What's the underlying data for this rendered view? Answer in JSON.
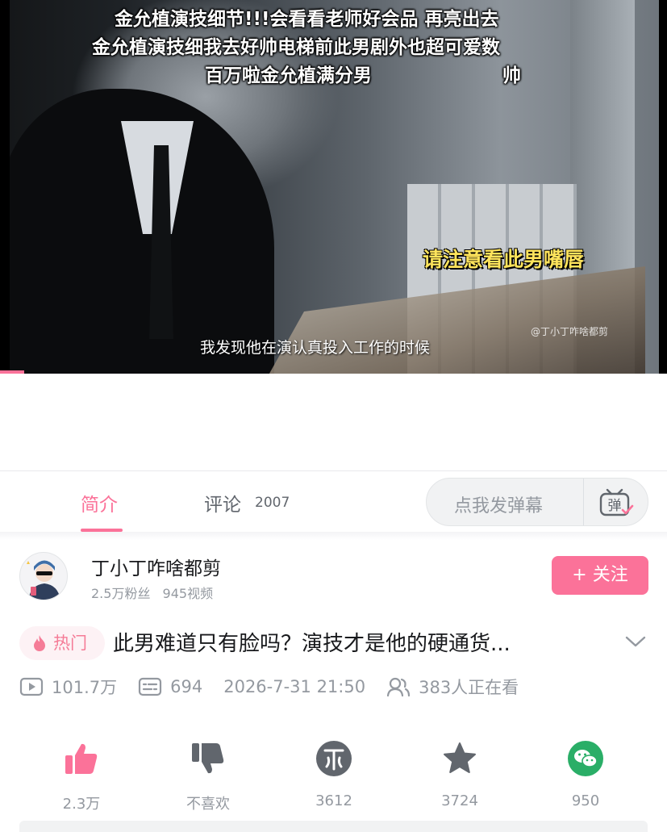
{
  "video": {
    "danmaku_lines": [
      "金允植演技细节!!!会看看老师好会品 再亮出去",
      "金允植演技细我去好帅电梯前此男剧外也超可爱数",
      "百万啦金允植满分男",
      "帅"
    ],
    "caption_highlight": "请注意看此男嘴唇",
    "subtitle": "我发现他在演认真投入工作的时候",
    "watermark": "@丁小丁咋啥都剪",
    "progress": 0.036
  },
  "tabs": {
    "intro_label": "简介",
    "comments_label": "评论",
    "comments_count": "2007",
    "danmaku_placeholder": "点我发弹幕",
    "danmaku_button_label": "弹"
  },
  "uploader": {
    "name": "丁小丁咋啥都剪",
    "fans": "2.5万粉丝",
    "videos": "945视频",
    "follow_label": "+ 关注"
  },
  "title": {
    "badge": "热门",
    "text": "此男难道只有脸吗？演技才是他的硬通货..."
  },
  "stats": {
    "plays": "101.7万",
    "danmaku_count": "694",
    "datetime": "2026-7-31 21:50",
    "watching": "383人正在看"
  },
  "actions": {
    "like": "2.3万",
    "dislike": "不喜欢",
    "coin": "3612",
    "favorite": "3724",
    "share": "950"
  },
  "colors": {
    "accent": "#fb7299",
    "wechat": "#2aae67",
    "icon_gray": "#61666d"
  }
}
